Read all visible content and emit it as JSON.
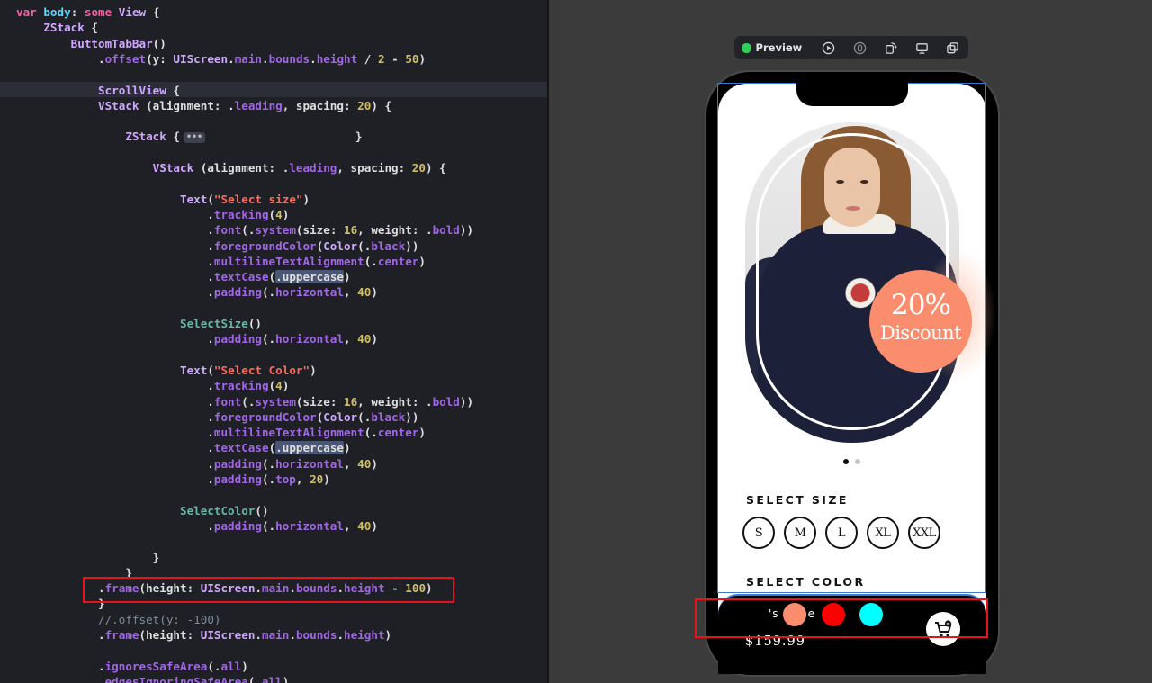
{
  "editor": {
    "lines": [
      [
        [
          "kw",
          "var"
        ],
        [
          "pl",
          " "
        ],
        [
          "mt",
          "body"
        ],
        [
          "pl",
          ": "
        ],
        [
          "kw",
          "some"
        ],
        [
          "pl",
          " "
        ],
        [
          "ty",
          "View"
        ],
        [
          "pl",
          " {"
        ]
      ],
      [
        [
          "pl",
          "    "
        ],
        [
          "ty",
          "ZStack"
        ],
        [
          "pl",
          " {"
        ]
      ],
      [
        [
          "pl",
          "        "
        ],
        [
          "ty",
          "ButtomTabBar"
        ],
        [
          "pl",
          "()"
        ]
      ],
      [
        [
          "pl",
          "            ."
        ],
        [
          "fn",
          "offset"
        ],
        [
          "pl",
          "(y: "
        ],
        [
          "ty",
          "UIScreen"
        ],
        [
          "pl",
          "."
        ],
        [
          "fn",
          "main"
        ],
        [
          "pl",
          "."
        ],
        [
          "fn",
          "bounds"
        ],
        [
          "pl",
          "."
        ],
        [
          "fn",
          "height"
        ],
        [
          "pl",
          " / "
        ],
        [
          "num",
          "2"
        ],
        [
          "pl",
          " - "
        ],
        [
          "num",
          "50"
        ],
        [
          "pl",
          ")"
        ]
      ],
      [],
      [
        [
          "pl",
          "            "
        ],
        [
          "ty",
          "ScrollView"
        ],
        [
          "pl",
          " {"
        ]
      ],
      [
        [
          "pl",
          "            "
        ],
        [
          "ty",
          "VStack"
        ],
        [
          "pl",
          " (alignment: ."
        ],
        [
          "fn",
          "leading"
        ],
        [
          "pl",
          ", spacing: "
        ],
        [
          "num",
          "20"
        ],
        [
          "pl",
          ") {"
        ]
      ],
      [],
      [
        [
          "pl",
          "                "
        ],
        [
          "ty",
          "ZStack"
        ],
        [
          "pl",
          " {"
        ],
        [
          "dots",
          "•••"
        ],
        [
          "pl",
          "                      }"
        ]
      ],
      [],
      [
        [
          "pl",
          "                    "
        ],
        [
          "ty",
          "VStack"
        ],
        [
          "pl",
          " (alignment: ."
        ],
        [
          "fn",
          "leading"
        ],
        [
          "pl",
          ", spacing: "
        ],
        [
          "num",
          "20"
        ],
        [
          "pl",
          ") {"
        ]
      ],
      [],
      [
        [
          "pl",
          "                        "
        ],
        [
          "ty",
          "Text"
        ],
        [
          "pl",
          "("
        ],
        [
          "str",
          "\"Select size\""
        ],
        [
          "pl",
          ")"
        ]
      ],
      [
        [
          "pl",
          "                            ."
        ],
        [
          "fn",
          "tracking"
        ],
        [
          "pl",
          "("
        ],
        [
          "num",
          "4"
        ],
        [
          "pl",
          ")"
        ]
      ],
      [
        [
          "pl",
          "                            ."
        ],
        [
          "fn",
          "font"
        ],
        [
          "pl",
          "(."
        ],
        [
          "fn",
          "system"
        ],
        [
          "pl",
          "(size: "
        ],
        [
          "num",
          "16"
        ],
        [
          "pl",
          ", weight: ."
        ],
        [
          "fn",
          "bold"
        ],
        [
          "pl",
          "))"
        ]
      ],
      [
        [
          "pl",
          "                            ."
        ],
        [
          "fn",
          "foregroundColor"
        ],
        [
          "pl",
          "("
        ],
        [
          "ty",
          "Color"
        ],
        [
          "pl",
          "(."
        ],
        [
          "fn",
          "black"
        ],
        [
          "pl",
          "))"
        ]
      ],
      [
        [
          "pl",
          "                            ."
        ],
        [
          "fn",
          "multilineTextAlignment"
        ],
        [
          "pl",
          "(."
        ],
        [
          "fn",
          "center"
        ],
        [
          "pl",
          ")"
        ]
      ],
      [
        [
          "pl",
          "                            ."
        ],
        [
          "fn",
          "textCase"
        ],
        [
          "pl",
          "("
        ],
        [
          "sel",
          ".uppercase"
        ],
        [
          "pl",
          ")"
        ]
      ],
      [
        [
          "pl",
          "                            ."
        ],
        [
          "fn",
          "padding"
        ],
        [
          "pl",
          "(."
        ],
        [
          "fn",
          "horizontal"
        ],
        [
          "pl",
          ", "
        ],
        [
          "num",
          "40"
        ],
        [
          "pl",
          ")"
        ]
      ],
      [],
      [
        [
          "pl",
          "                        "
        ],
        [
          "pr",
          "SelectSize"
        ],
        [
          "pl",
          "()"
        ]
      ],
      [
        [
          "pl",
          "                            ."
        ],
        [
          "fn",
          "padding"
        ],
        [
          "pl",
          "(."
        ],
        [
          "fn",
          "horizontal"
        ],
        [
          "pl",
          ", "
        ],
        [
          "num",
          "40"
        ],
        [
          "pl",
          ")"
        ]
      ],
      [],
      [
        [
          "pl",
          "                        "
        ],
        [
          "ty",
          "Text"
        ],
        [
          "pl",
          "("
        ],
        [
          "str",
          "\"Select Color\""
        ],
        [
          "pl",
          ")"
        ]
      ],
      [
        [
          "pl",
          "                            ."
        ],
        [
          "fn",
          "tracking"
        ],
        [
          "pl",
          "("
        ],
        [
          "num",
          "4"
        ],
        [
          "pl",
          ")"
        ]
      ],
      [
        [
          "pl",
          "                            ."
        ],
        [
          "fn",
          "font"
        ],
        [
          "pl",
          "(."
        ],
        [
          "fn",
          "system"
        ],
        [
          "pl",
          "(size: "
        ],
        [
          "num",
          "16"
        ],
        [
          "pl",
          ", weight: ."
        ],
        [
          "fn",
          "bold"
        ],
        [
          "pl",
          "))"
        ]
      ],
      [
        [
          "pl",
          "                            ."
        ],
        [
          "fn",
          "foregroundColor"
        ],
        [
          "pl",
          "("
        ],
        [
          "ty",
          "Color"
        ],
        [
          "pl",
          "(."
        ],
        [
          "fn",
          "black"
        ],
        [
          "pl",
          "))"
        ]
      ],
      [
        [
          "pl",
          "                            ."
        ],
        [
          "fn",
          "multilineTextAlignment"
        ],
        [
          "pl",
          "(."
        ],
        [
          "fn",
          "center"
        ],
        [
          "pl",
          ")"
        ]
      ],
      [
        [
          "pl",
          "                            ."
        ],
        [
          "fn",
          "textCase"
        ],
        [
          "pl",
          "("
        ],
        [
          "sel",
          ".uppercase"
        ],
        [
          "pl",
          ")"
        ]
      ],
      [
        [
          "pl",
          "                            ."
        ],
        [
          "fn",
          "padding"
        ],
        [
          "pl",
          "(."
        ],
        [
          "fn",
          "horizontal"
        ],
        [
          "pl",
          ", "
        ],
        [
          "num",
          "40"
        ],
        [
          "pl",
          ")"
        ]
      ],
      [
        [
          "pl",
          "                            ."
        ],
        [
          "fn",
          "padding"
        ],
        [
          "pl",
          "(."
        ],
        [
          "fn",
          "top"
        ],
        [
          "pl",
          ", "
        ],
        [
          "num",
          "20"
        ],
        [
          "pl",
          ")"
        ]
      ],
      [],
      [
        [
          "pl",
          "                        "
        ],
        [
          "pr",
          "SelectColor"
        ],
        [
          "pl",
          "()"
        ]
      ],
      [
        [
          "pl",
          "                            ."
        ],
        [
          "fn",
          "padding"
        ],
        [
          "pl",
          "(."
        ],
        [
          "fn",
          "horizontal"
        ],
        [
          "pl",
          ", "
        ],
        [
          "num",
          "40"
        ],
        [
          "pl",
          ")"
        ]
      ],
      [],
      [
        [
          "pl",
          "                    }"
        ]
      ],
      [
        [
          "pl",
          "                }"
        ]
      ],
      [
        [
          "pl",
          "            ."
        ],
        [
          "fn",
          "frame"
        ],
        [
          "pl",
          "(height: "
        ],
        [
          "ty",
          "UIScreen"
        ],
        [
          "pl",
          "."
        ],
        [
          "fn",
          "main"
        ],
        [
          "pl",
          "."
        ],
        [
          "fn",
          "bounds"
        ],
        [
          "pl",
          "."
        ],
        [
          "fn",
          "height"
        ],
        [
          "pl",
          " - "
        ],
        [
          "num",
          "100"
        ],
        [
          "pl",
          ")"
        ]
      ],
      [
        [
          "pl",
          "            }"
        ]
      ],
      [
        [
          "pl",
          "            "
        ],
        [
          "cm",
          "//.offset(y: -100)"
        ]
      ],
      [
        [
          "pl",
          "            ."
        ],
        [
          "fn",
          "frame"
        ],
        [
          "pl",
          "(height: "
        ],
        [
          "ty",
          "UIScreen"
        ],
        [
          "pl",
          "."
        ],
        [
          "fn",
          "main"
        ],
        [
          "pl",
          "."
        ],
        [
          "fn",
          "bounds"
        ],
        [
          "pl",
          "."
        ],
        [
          "fn",
          "height"
        ],
        [
          "pl",
          ")"
        ]
      ],
      [],
      [
        [
          "pl",
          "            ."
        ],
        [
          "fn",
          "ignoresSafeArea"
        ],
        [
          "pl",
          "(."
        ],
        [
          "fn",
          "all"
        ],
        [
          "pl",
          ")"
        ]
      ],
      [
        [
          "pl",
          "            ."
        ],
        [
          "fn",
          "edgesIgnoringSafeArea"
        ],
        [
          "pl",
          "(."
        ],
        [
          "fn",
          "all"
        ],
        [
          "pl",
          ")"
        ]
      ]
    ]
  },
  "preview": {
    "toolbar": {
      "label": "Preview",
      "live_color": "#30d158",
      "buttons": [
        "live-play-icon",
        "inspect-icon",
        "rotate-device-icon",
        "device-settings-icon",
        "duplicate-icon"
      ]
    },
    "app": {
      "discount": {
        "percent": "20%",
        "word": "Discount",
        "color": "#fb8d6f"
      },
      "pager": {
        "count": 2,
        "active": 0
      },
      "select_size_title": "SELECT SIZE",
      "sizes": [
        "S",
        "M",
        "L",
        "XL",
        "XXL"
      ],
      "select_color_title": "SELECT COLOR",
      "colors": [
        "#fb8d6f",
        "#ff0000",
        "#00ffff"
      ],
      "name_peek": "'s      te      ee",
      "price": "$159.99",
      "cart_icon": "cart-icon"
    }
  }
}
